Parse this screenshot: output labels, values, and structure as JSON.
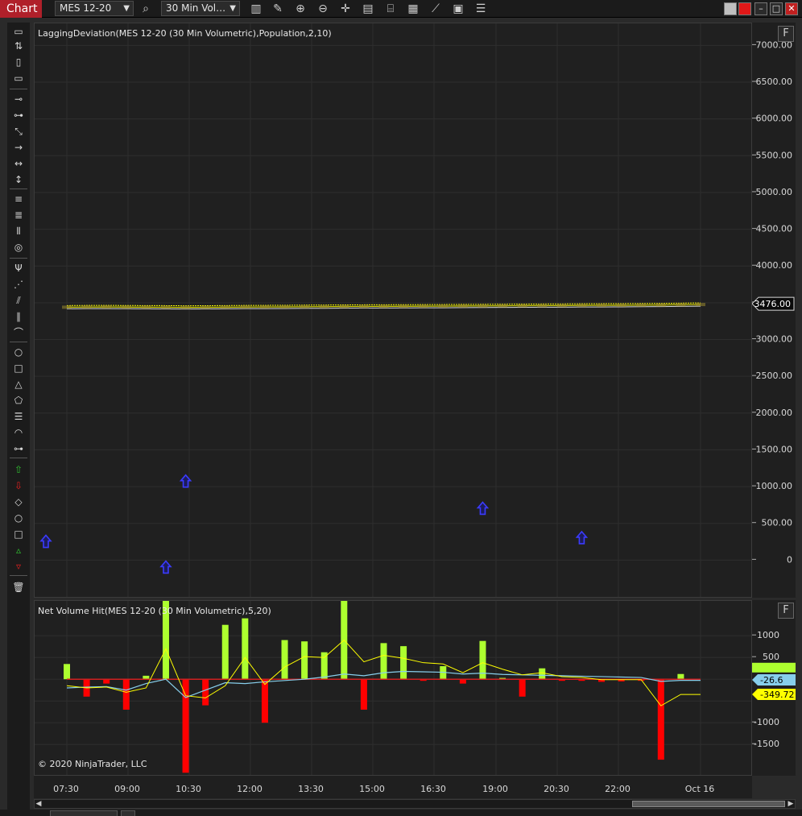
{
  "toolbar": {
    "chart_tab": "Chart",
    "instrument": "MES 12-20",
    "interval": "30 Min Vol…",
    "icons": [
      "search-icon",
      "bar-type-icon",
      "pencil-icon",
      "zoom-in-icon",
      "zoom-out-icon",
      "crosshair-icon",
      "data-box-icon",
      "indicators-icon",
      "strategies-icon",
      "performance-icon",
      "properties-icon",
      "templates-icon"
    ]
  },
  "window_buttons": {
    "minimize": "–",
    "restore": "□",
    "close": "✕"
  },
  "main_panel": {
    "title": "LaggingDeviation(MES 12-20 (30 Min Volumetric),Population,2,10)",
    "f_label": "F",
    "price_ticks": [
      "7000.00",
      "6500.00",
      "6000.00",
      "5500.00",
      "5000.00",
      "4500.00",
      "4000.00",
      "3500.00",
      "3000.00",
      "2500.00",
      "2000.00",
      "1500.00",
      "1000.00",
      "500.00",
      "0"
    ],
    "current_price_label": "3476.00",
    "current_price": 3476
  },
  "sub_panel": {
    "title": "Net Volume Hit(MES 12-20 (30 Min Volumetric),5,20)",
    "f_label": "F",
    "ticks": [
      "1000",
      "500",
      "-1000",
      "-1500"
    ],
    "badges": [
      "-26.6",
      "-349.72"
    ],
    "copyright": "© 2020 NinjaTrader, LLC"
  },
  "time_axis": {
    "labels": [
      "07:30",
      "09:00",
      "10:30",
      "12:00",
      "13:30",
      "15:00",
      "16:30",
      "19:00",
      "20:30",
      "22:00",
      "Oct 16"
    ]
  },
  "colors": {
    "positive_bar": "#adff2f",
    "negative_bar": "#ff0000",
    "fast_line": "#ffff00",
    "slow_line": "#87ceeb",
    "price_line": "#ffff00",
    "arrow": "#3b3bff"
  },
  "chart_data": [
    {
      "type": "line",
      "x": [
        "07:30",
        "08:00",
        "08:30",
        "09:00",
        "09:30",
        "10:00",
        "10:30",
        "11:00",
        "11:30",
        "12:00",
        "12:30",
        "13:00",
        "13:30",
        "14:00",
        "14:30",
        "15:00",
        "15:30",
        "16:00",
        "16:30",
        "17:00",
        "18:00",
        "18:30",
        "19:00",
        "19:30",
        "20:00",
        "20:30",
        "21:00",
        "21:30",
        "22:00",
        "22:30",
        "23:00",
        "23:30",
        "Oct 16"
      ],
      "series": [
        {
          "values": [
            3440,
            3442,
            3443,
            3441,
            3440,
            3439,
            3437,
            3438,
            3440,
            3442,
            3443,
            3444,
            3446,
            3447,
            3449,
            3450,
            3451,
            3452,
            3453,
            3454,
            3456,
            3457,
            3459,
            3460,
            3461,
            3462,
            3464,
            3465,
            3466,
            3468,
            3470,
            3473,
            3476
          ]
        }
      ],
      "ylim": [
        -500,
        7300
      ]
    },
    {
      "type": "scatter",
      "marker": "up-arrow",
      "x": [
        "07:00",
        "10:00",
        "10:30",
        "18:30",
        "21:00"
      ],
      "y": [
        250,
        -100,
        1070,
        700,
        300
      ]
    },
    {
      "type": "bar",
      "x": [
        "07:30",
        "08:00",
        "08:30",
        "09:00",
        "09:30",
        "10:00",
        "10:30",
        "11:00",
        "11:30",
        "12:00",
        "12:30",
        "13:00",
        "13:30",
        "14:00",
        "14:30",
        "15:00",
        "15:30",
        "16:00",
        "16:30",
        "17:00",
        "18:00",
        "18:30",
        "19:00",
        "19:30",
        "20:00",
        "20:30",
        "21:00",
        "21:30",
        "22:00",
        "22:30",
        "23:00",
        "23:30",
        "Oct 16"
      ],
      "series": [
        {
          "values": [
            350,
            -400,
            -100,
            -700,
            80,
            1800,
            -2150,
            -600,
            1250,
            1400,
            -1000,
            900,
            870,
            620,
            1800,
            -700,
            830,
            760,
            -30,
            300,
            -100,
            880,
            30,
            -400,
            250,
            -10,
            -20,
            -60,
            -50,
            -10,
            -1850,
            120,
            0
          ]
        },
        {
          "values": [
            -200,
            -180,
            -170,
            -250,
            -100,
            0,
            -420,
            -250,
            -80,
            -100,
            -60,
            -30,
            0,
            50,
            120,
            80,
            150,
            180,
            170,
            160,
            120,
            140,
            110,
            100,
            90,
            80,
            70,
            60,
            50,
            40,
            -50,
            -26.6,
            -26.6
          ]
        },
        {
          "values": [
            -150,
            -200,
            -180,
            -300,
            -200,
            700,
            -380,
            -430,
            -150,
            500,
            -120,
            280,
            520,
            500,
            900,
            400,
            550,
            480,
            380,
            350,
            150,
            380,
            230,
            100,
            150,
            60,
            40,
            -10,
            -10,
            -10,
            -610,
            -349.72,
            -349.72
          ]
        }
      ],
      "ylim": [
        -2200,
        1800
      ]
    }
  ]
}
